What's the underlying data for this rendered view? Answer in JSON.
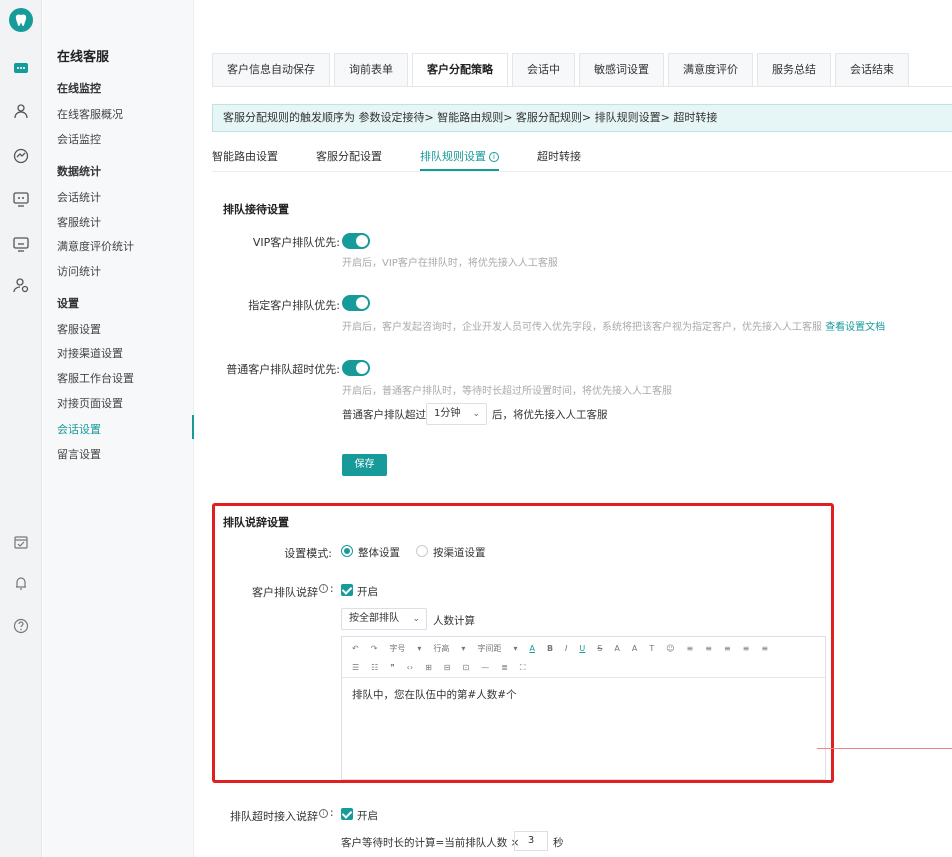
{
  "rail": {
    "icons": [
      "tooth-logo",
      "chat-icon",
      "user-icon",
      "chart-icon",
      "monitor-icon",
      "screen-icon",
      "users-icon",
      "calendar-icon",
      "bell-icon",
      "help-icon"
    ]
  },
  "nav": {
    "title": "在线客服",
    "groups": [
      {
        "label": "在线监控",
        "items": [
          "在线客服概况",
          "会话监控"
        ]
      },
      {
        "label": "数据统计",
        "items": [
          "会话统计",
          "客服统计",
          "满意度评价统计",
          "访问统计"
        ]
      },
      {
        "label": "设置",
        "items": [
          "客服设置",
          "对接渠道设置",
          "客服工作台设置",
          "对接页面设置",
          "会话设置",
          "留言设置"
        ]
      }
    ],
    "active": "会话设置"
  },
  "tabs": [
    "客户信息自动保存",
    "询前表单",
    "客户分配策略",
    "会话中",
    "敏感词设置",
    "满意度评价",
    "服务总结",
    "会话结束"
  ],
  "active_tab": "客户分配策略",
  "notice": "客服分配规则的触发顺序为 参数设定接待> 智能路由规则> 客服分配规则> 排队规则设置> 超时转接",
  "subtabs": [
    "智能路由设置",
    "客服分配设置",
    "排队规则设置",
    "超时转接"
  ],
  "active_subtab": "排队规则设置",
  "queue": {
    "title": "排队接待设置",
    "vip_label": "VIP客户排队优先:",
    "vip_hint": "开启后，VIP客户在排队时，将优先接入人工客服",
    "vip_on": true,
    "designated_label": "指定客户排队优先:",
    "designated_hint": "开启后，客户发起咨询时，企业开发人员可传入优先字段，系统将把该客户视为指定客户，优先接入人工客服",
    "designated_link": "查看设置文档",
    "designated_on": true,
    "timeout_label": "普通客户排队超时优先:",
    "timeout_hint": "开启后，普通客户排队时，等待时长超过所设置时间，将优先接入人工客服",
    "timeout_on": true,
    "timeout_prefix": "普通客户排队超过",
    "timeout_value": "1分钟",
    "timeout_suffix": "后，将优先接入人工客服",
    "save": "保存"
  },
  "speech": {
    "title": "排队说辞设置",
    "mode_label": "设置模式:",
    "mode_options": [
      "整体设置",
      "按渠道设置"
    ],
    "mode_selected": "整体设置",
    "speech_label": "客户排队说辞",
    "speech_check": "开启",
    "count_select": "按全部排队",
    "count_suffix": "人数计算",
    "toolbar1": [
      "↶",
      "↷",
      "字号",
      "▾",
      "行高",
      "▾",
      "字间距",
      "▾",
      "A",
      "B",
      "I",
      "U",
      "S",
      "A",
      "A",
      "T",
      "☺",
      "≡",
      "≡",
      "≡",
      "≡",
      "≡"
    ],
    "toolbar2": [
      "☰",
      "☷",
      "❞",
      "‹›",
      "⊞",
      "⊟",
      "⊡",
      "—",
      "≣",
      "⛶"
    ],
    "content": "排队中，您在队伍中的第#人数#个"
  },
  "timeout_speech": {
    "label": "排队超时接入说辞",
    "check": "开启",
    "calc_prefix": "客户等待时长的计算=当前排队人数 ×",
    "calc_value": "3",
    "calc_unit": "秒"
  },
  "colors": {
    "accent": "#179a9a",
    "highlight_box": "#e02020"
  }
}
